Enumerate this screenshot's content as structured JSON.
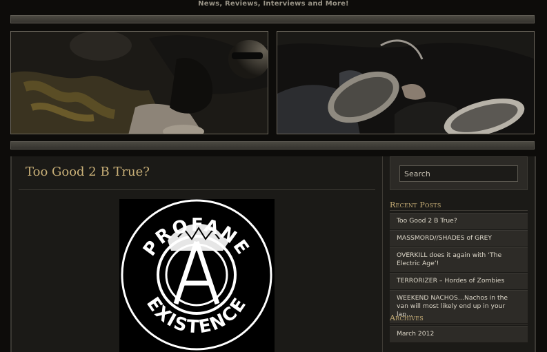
{
  "header": {
    "tagline": "News, Reviews, Interviews and More!"
  },
  "post": {
    "title": "Too Good 2 B True?",
    "image_text": "PROFANE EXISTENCE"
  },
  "sidebar": {
    "search": {
      "placeholder": "Search"
    },
    "recent_posts": {
      "title": "Recent Posts",
      "items": [
        {
          "label": "Too Good 2 B True?"
        },
        {
          "label": "MASSMORD//SHADES of GREY"
        },
        {
          "label": "OVERKILL does it again with ‘The Electric Age’!"
        },
        {
          "label": "TERRORIZER – Hordes of Zombies"
        },
        {
          "label": "WEEKEND NACHOS…Nachos in the van will most likely end up in your lap…"
        }
      ]
    },
    "archives": {
      "title": "Archives",
      "items": [
        {
          "label": "March 2012"
        }
      ]
    }
  },
  "colors": {
    "background": "#0d0c0a",
    "accent_title": "#c9b078",
    "panel": "#2d2b27"
  }
}
